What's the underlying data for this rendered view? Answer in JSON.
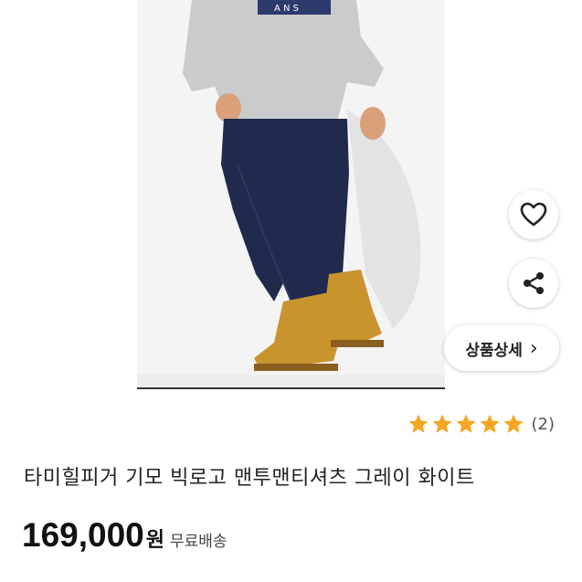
{
  "product": {
    "rating_stars": 5,
    "review_count": "(2)",
    "title": "타미힐피거 기모 빅로고 맨투맨티셔츠 그레이 화이트",
    "price": "169,000",
    "price_unit": "원",
    "shipping": "무료배송"
  },
  "actions": {
    "heart_icon": "heart-icon",
    "share_icon": "share-icon",
    "detail_label": "상품상세",
    "detail_chevron": "›"
  },
  "colors": {
    "star": "#f5a623",
    "text": "#222222",
    "jeans": "#1f2a4d",
    "sweatshirt": "#c9cbcd",
    "boots": "#c9932e"
  }
}
